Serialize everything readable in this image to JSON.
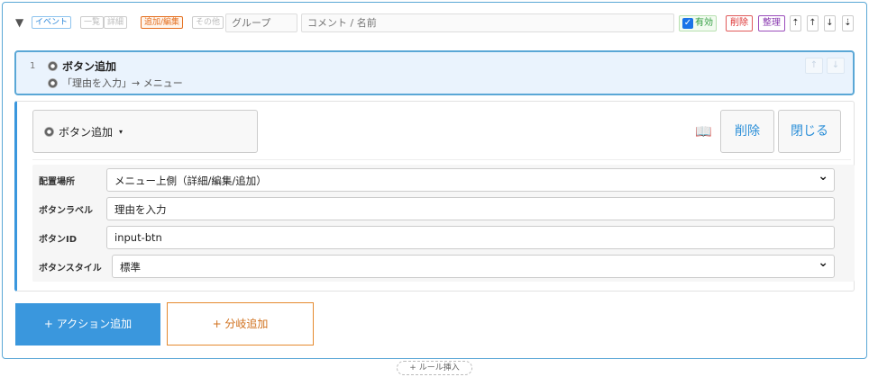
{
  "toolbar": {
    "collapse_glyph": "▼",
    "tags": {
      "event": "イベント",
      "list": "一覧",
      "detail": "詳細",
      "add_edit": "追加/編集",
      "other": "その他"
    },
    "group_placeholder": "グループ",
    "comment_placeholder": "コメント / 名前",
    "enabled_label": "有効",
    "enabled_checked": true,
    "delete_label": "削除",
    "organize_label": "整理",
    "move_top": "⇡",
    "move_up": "↑",
    "move_down": "↓",
    "move_bottom": "⇣"
  },
  "rule": {
    "number": "1",
    "title": "ボタン追加",
    "action_summary": "「理由を入力」→ メニュー",
    "up": "↑",
    "down": "↓"
  },
  "editor": {
    "type_label": "ボタン追加",
    "type_caret": "▾",
    "help_icon": "📖",
    "delete_label": "削除",
    "close_label": "閉じる",
    "fields": {
      "placement_label": "配置場所",
      "placement_value": "メニュー上側（詳細/編集/追加）",
      "button_label_label": "ボタンラベル",
      "button_label_value": "理由を入力",
      "button_id_label": "ボタンID",
      "button_id_value": "input-btn",
      "button_style_label": "ボタンスタイル",
      "button_style_value": "標準"
    }
  },
  "footer": {
    "add_action": "+ アクション追加",
    "add_branch": "+ 分岐追加",
    "insert_rule": "+ ルール挿入"
  },
  "colors": {
    "accent": "#3a97dd",
    "branch": "#e58a2e",
    "enabled": "#2a9a3a",
    "delete": "#d33333",
    "organize": "#8a3bb0"
  }
}
